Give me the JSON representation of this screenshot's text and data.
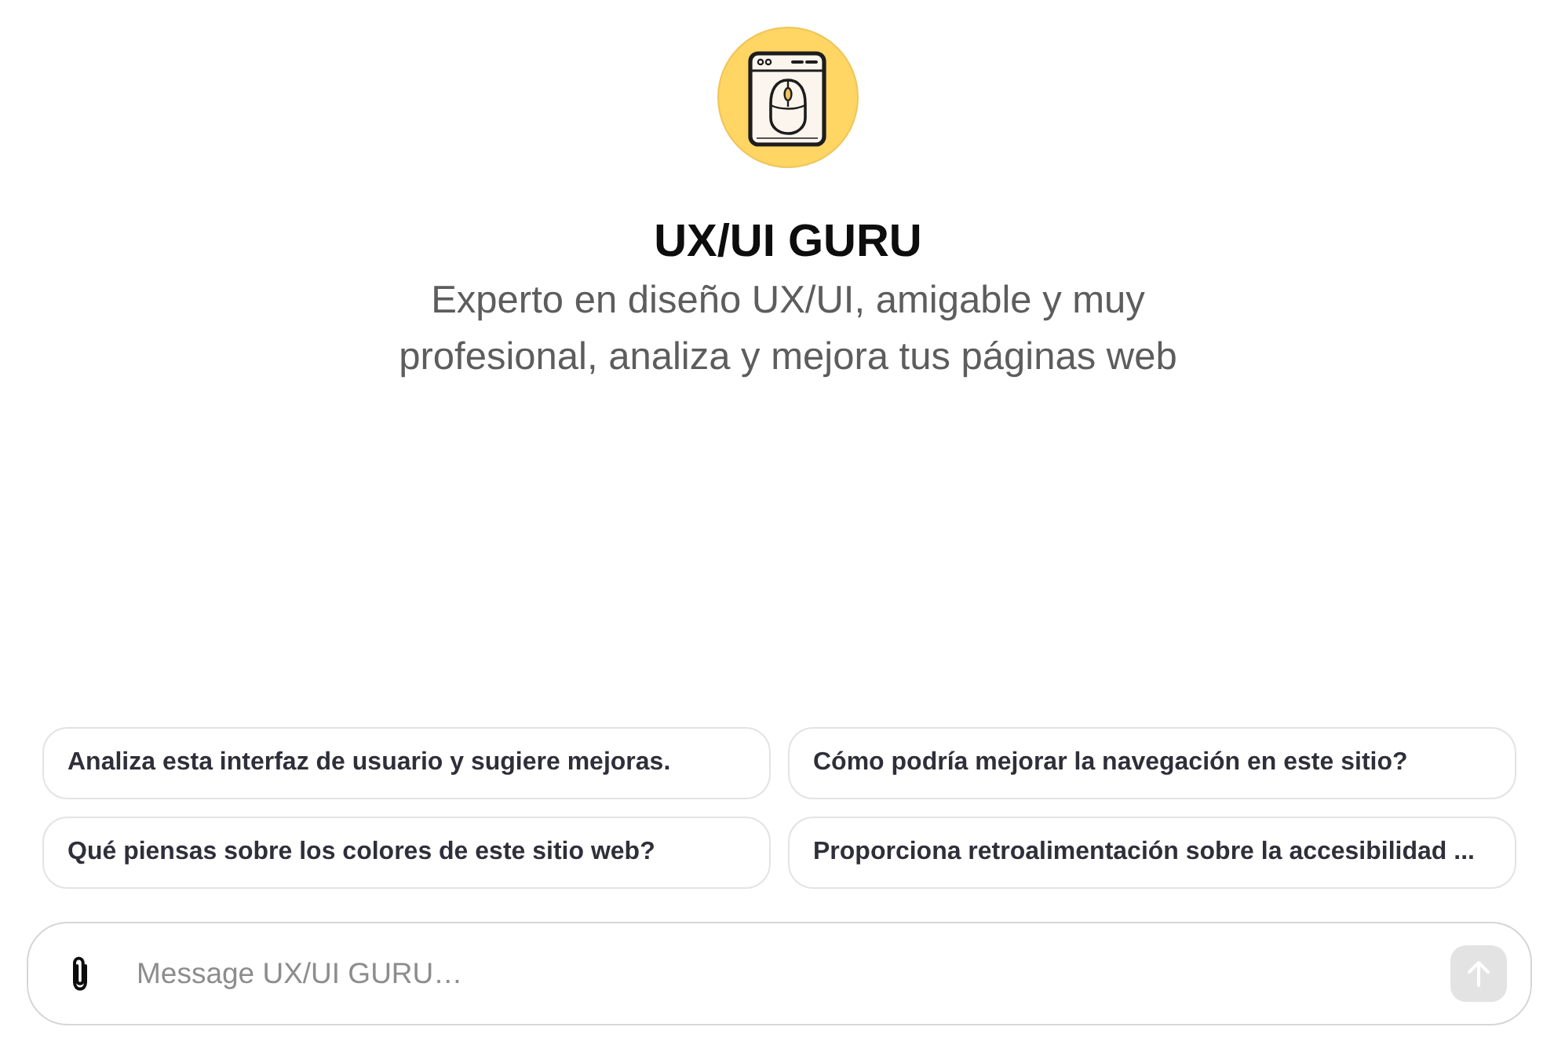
{
  "assistant": {
    "name": "UX/UI GURU",
    "description": "Experto en diseño UX/UI, amigable y muy profesional, analiza y mejora tus páginas web"
  },
  "suggestions": [
    "Analiza esta interfaz de usuario y sugiere mejoras.",
    "Cómo podría mejorar la navegación en este sitio?",
    "Qué piensas sobre los colores de este sitio web?",
    "Proporciona retroalimentación sobre la accesibilidad ..."
  ],
  "composer": {
    "placeholder": "Message UX/UI GURU…",
    "send_disabled": true
  }
}
